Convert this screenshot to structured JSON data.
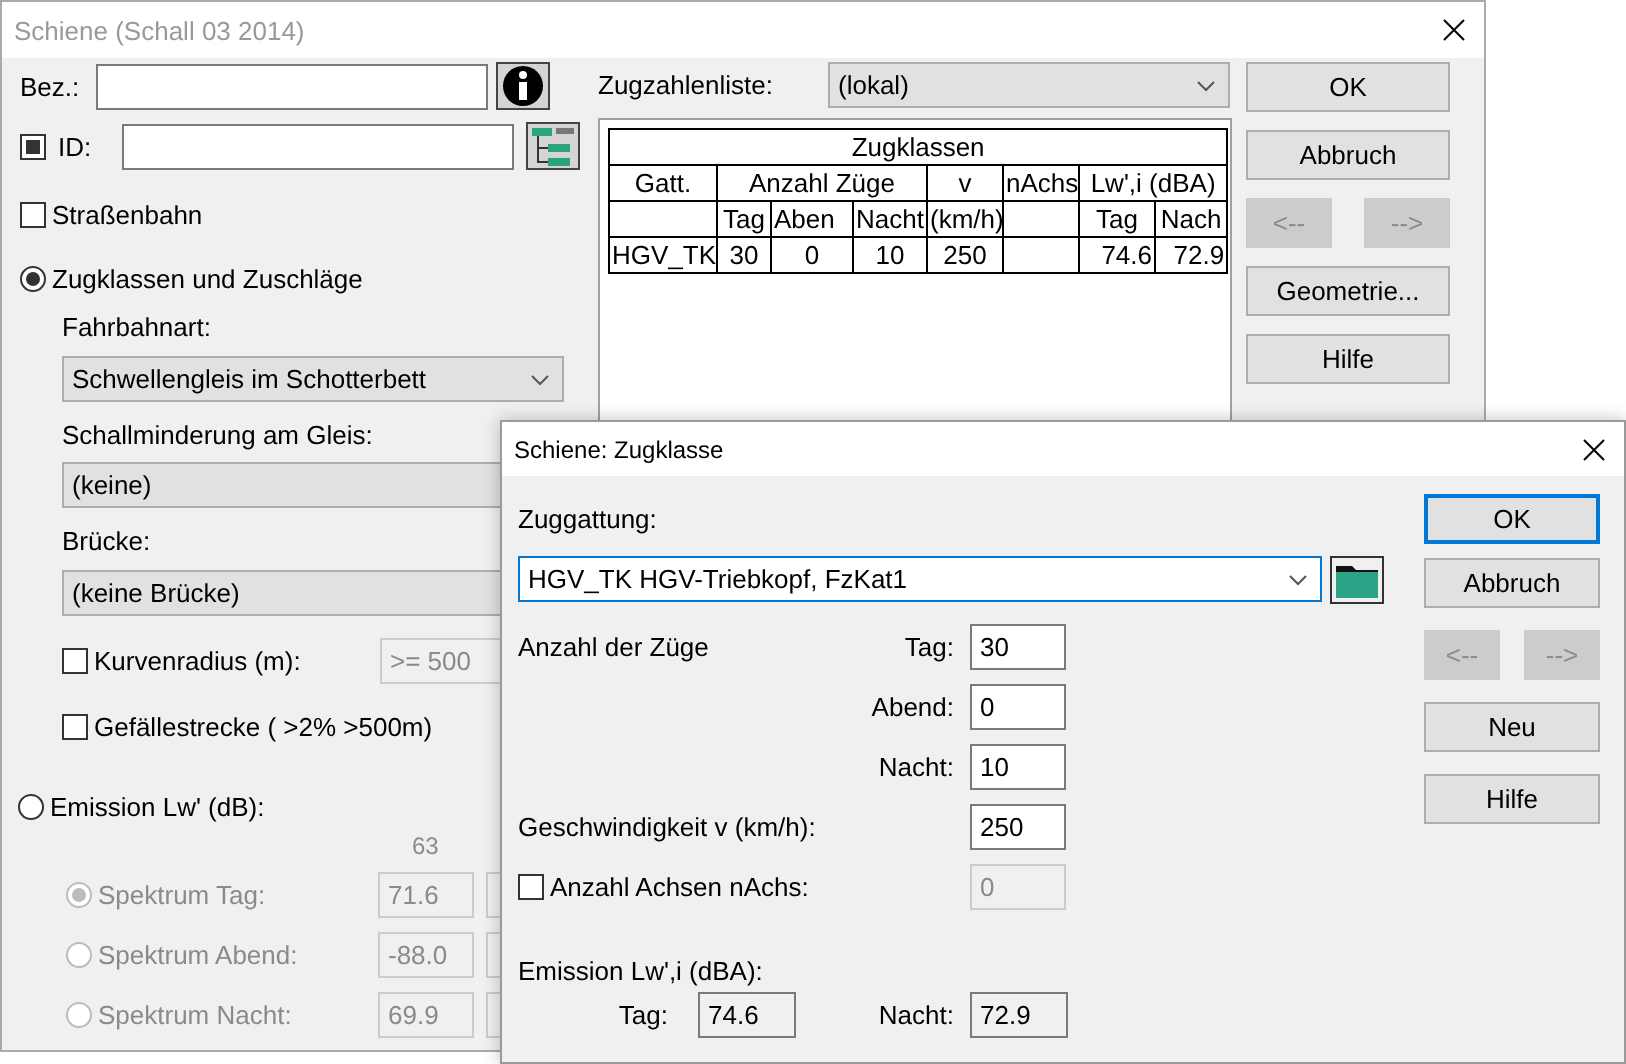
{
  "main_window": {
    "title": "Schiene (Schall 03 2014)",
    "name_field": {
      "label": "Bez.:"
    },
    "id_field": {
      "label": "ID:",
      "checked": true
    },
    "strassenbahn": {
      "label": "Straßenbahn",
      "checked": false
    },
    "mode_options": [
      {
        "label": "Zugklassen und Zuschläge",
        "selected": true
      },
      {
        "label": "Emission Lw' (dB):",
        "selected": false
      }
    ],
    "fahrbahnart": {
      "label": "Fahrbahnart:",
      "value": "Schwellengleis im Schotterbett"
    },
    "schallminderung": {
      "label": "Schallminderung am Gleis:",
      "value": "(keine)"
    },
    "bruecke": {
      "label": "Brücke:",
      "value": "(keine Brücke)"
    },
    "kurvenradius": {
      "label": "Kurvenradius (m):",
      "checked": false,
      "value": ">= 500"
    },
    "gefaelle": {
      "label": "Gefällestrecke ( >2% >500m)",
      "checked": false
    },
    "spectrum": {
      "disabled": true,
      "band_header": "63",
      "rows": [
        {
          "label": "Spektrum Tag:",
          "selected": true,
          "value": "71.6"
        },
        {
          "label": "Spektrum Abend:",
          "selected": false,
          "value": "-88.0"
        },
        {
          "label": "Spektrum Nacht:",
          "selected": false,
          "value": "69.9"
        }
      ]
    },
    "zugzahlenliste": {
      "label": "Zugzahlenliste:",
      "value": "(lokal)"
    },
    "zugklassen_table": {
      "title": "Zugklassen",
      "header_groups": [
        "Gatt.",
        "Anzahl Züge",
        "v",
        "nAchs",
        "Lw',i (dBA)"
      ],
      "subheaders": {
        "tag": "Tag",
        "abend": "Aben",
        "nacht": "Nacht",
        "v": "(km/h)",
        "lw_tag": "Tag",
        "lw_nacht": "Nach"
      },
      "rows": [
        {
          "gatt": "HGV_TK",
          "tag": "30",
          "abend": "0",
          "nacht": "10",
          "v": "250",
          "lw_tag": "74.6",
          "lw_nacht": "72.9"
        }
      ]
    },
    "buttons": [
      {
        "label": "OK",
        "disabled": false,
        "kind": "wide"
      },
      {
        "label": "Abbruch",
        "disabled": false,
        "kind": "wide"
      },
      {
        "label": "<--",
        "disabled": true,
        "kind": "half"
      },
      {
        "label": "-->",
        "disabled": true,
        "kind": "half"
      },
      {
        "label": "Geometrie...",
        "disabled": false,
        "kind": "wide"
      },
      {
        "label": "Hilfe",
        "disabled": false,
        "kind": "wide"
      }
    ]
  },
  "zugklasse_dialog": {
    "title": "Schiene: Zugklasse",
    "zuggattung": {
      "label": "Zuggattung:",
      "value": "HGV_TK HGV-Triebkopf, FzKat1"
    },
    "counts_label": "Anzahl der Züge",
    "counts": [
      {
        "label": "Tag:",
        "value": "30"
      },
      {
        "label": "Abend:",
        "value": "0"
      },
      {
        "label": "Nacht:",
        "value": "10"
      }
    ],
    "speed": {
      "label": "Geschwindigkeit v (km/h):",
      "value": "250"
    },
    "axles": {
      "label": "Anzahl Achsen nAchs:",
      "checked": false,
      "value": "0"
    },
    "emission": {
      "label": "Emission Lw',i (dBA):",
      "values": [
        {
          "label": "Tag:",
          "value": "74.6"
        },
        {
          "label": "Nacht:",
          "value": "72.9"
        }
      ]
    },
    "buttons": [
      {
        "label": "OK",
        "disabled": false,
        "default": true,
        "kind": "wide"
      },
      {
        "label": "Abbruch",
        "disabled": false,
        "default": false,
        "kind": "wide"
      },
      {
        "label": "<--",
        "disabled": true,
        "default": false,
        "kind": "half"
      },
      {
        "label": "-->",
        "disabled": true,
        "default": false,
        "kind": "half"
      },
      {
        "label": "Neu",
        "disabled": false,
        "default": false,
        "kind": "wide"
      },
      {
        "label": "Hilfe",
        "disabled": false,
        "default": false,
        "kind": "wide"
      }
    ]
  }
}
